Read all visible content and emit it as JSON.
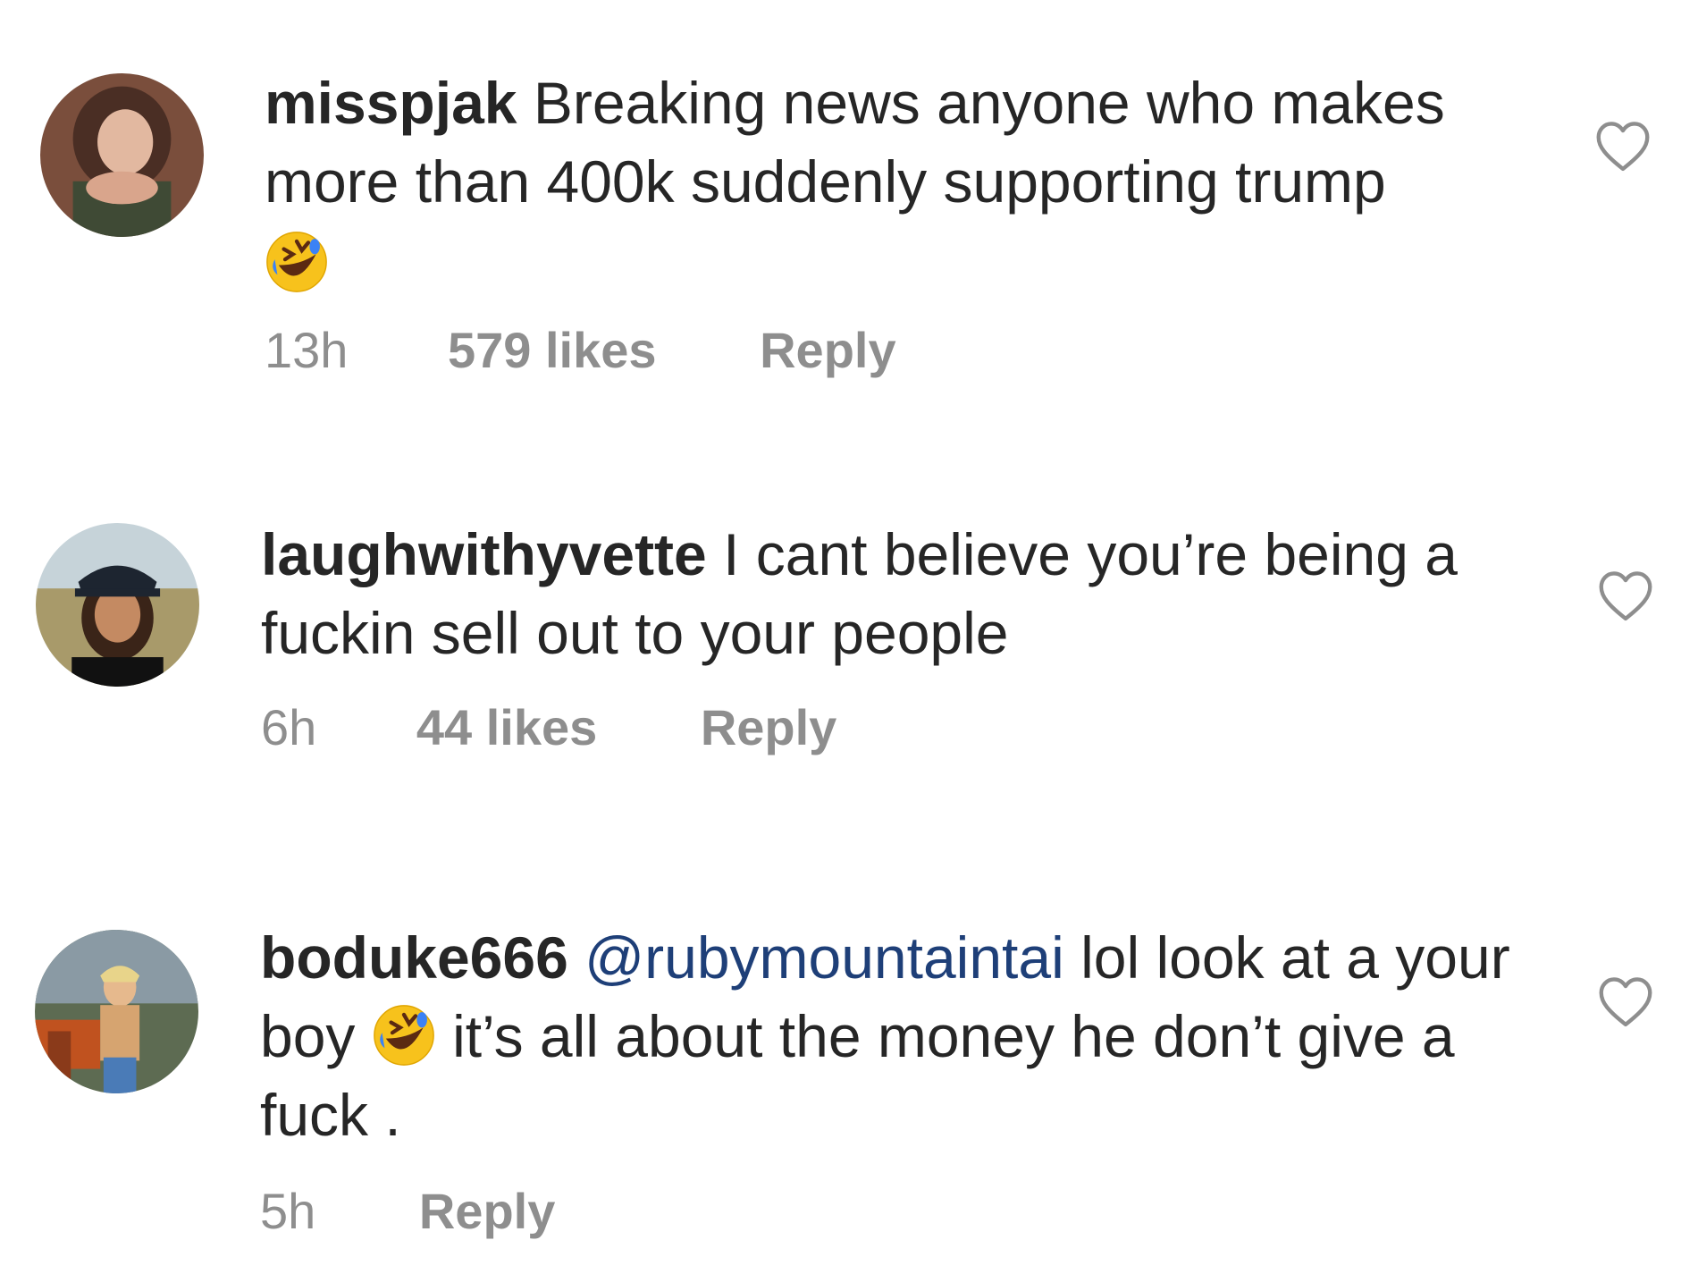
{
  "comments": [
    {
      "username": "misspjak",
      "text_parts": [
        "Breaking news anyone who makes more than 400k suddenly supporting trump"
      ],
      "emoji_after": "rolling-on-floor-laughing-emoji",
      "time": "13h",
      "likes": "579 likes",
      "reply": "Reply",
      "like_icon": "heart-outline-icon"
    },
    {
      "username": "laughwithyvette",
      "text_parts": [
        "I cant believe you’re being a fuckin sell out to your people"
      ],
      "time": "6h",
      "likes": "44 likes",
      "reply": "Reply",
      "like_icon": "heart-outline-icon"
    },
    {
      "username": "boduke666",
      "mention": "@rubymountaintai",
      "text_parts": [
        "lol look at a your boy",
        "it’s all about the money he don’t give a fuck ."
      ],
      "emoji_inline": "rolling-on-floor-laughing-emoji",
      "time": "5h",
      "reply": "Reply",
      "like_icon": "heart-outline-icon"
    }
  ],
  "colors": {
    "text": "#262626",
    "meta": "#8e8e8e",
    "mention": "#1e3f78",
    "heart_outline": "#8e8e8e"
  }
}
